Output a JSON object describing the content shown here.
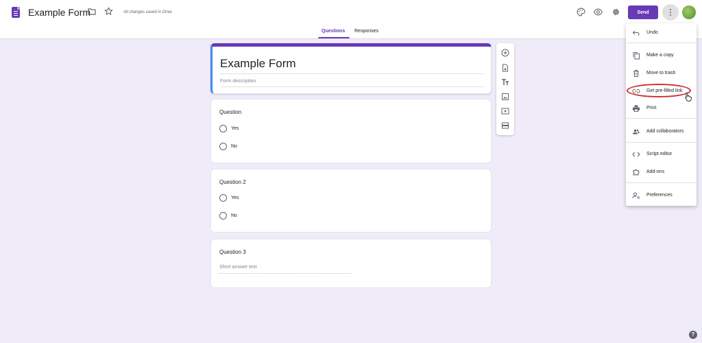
{
  "header": {
    "title": "Example Form",
    "save_status": "All changes saved in Drive",
    "send_label": "Send",
    "icons": [
      "forms-logo",
      "folder-icon",
      "star-icon",
      "palette-icon",
      "eye-icon",
      "gear-icon",
      "more-vert-icon",
      "avatar"
    ],
    "accent": "#673ab7"
  },
  "tabs": [
    {
      "label": "Questions",
      "active": true
    },
    {
      "label": "Responses",
      "active": false
    }
  ],
  "form": {
    "title": "Example Form",
    "description_placeholder": "Form description",
    "questions": [
      {
        "title": "Question",
        "type": "multiple-choice",
        "options": [
          "Yes",
          "No"
        ]
      },
      {
        "title": "Question 2",
        "type": "multiple-choice",
        "options": [
          "Yes",
          "No"
        ]
      },
      {
        "title": "Question 3",
        "type": "short-answer",
        "placeholder": "Short answer text"
      }
    ]
  },
  "toolbar": {
    "icons": [
      "add-question-icon",
      "import-questions-icon",
      "add-title-icon",
      "add-image-icon",
      "add-video-icon",
      "add-section-icon"
    ]
  },
  "menu": {
    "items": [
      {
        "label": "Undo",
        "icon": "undo-icon"
      },
      {
        "label": "Make a copy",
        "icon": "copy-icon"
      },
      {
        "label": "Move to trash",
        "icon": "trash-icon"
      },
      {
        "label": "Get pre-filled link",
        "icon": "link-icon",
        "highlighted": true
      },
      {
        "label": "Print",
        "icon": "print-icon"
      },
      {
        "label": "Add collaborators",
        "icon": "collaborators-icon"
      },
      {
        "label": "Script editor",
        "icon": "code-icon"
      },
      {
        "label": "Add-ons",
        "icon": "puzzle-icon"
      },
      {
        "label": "Preferences",
        "icon": "preferences-icon"
      }
    ],
    "highlight_color": "#d32f2f"
  },
  "help": "?"
}
